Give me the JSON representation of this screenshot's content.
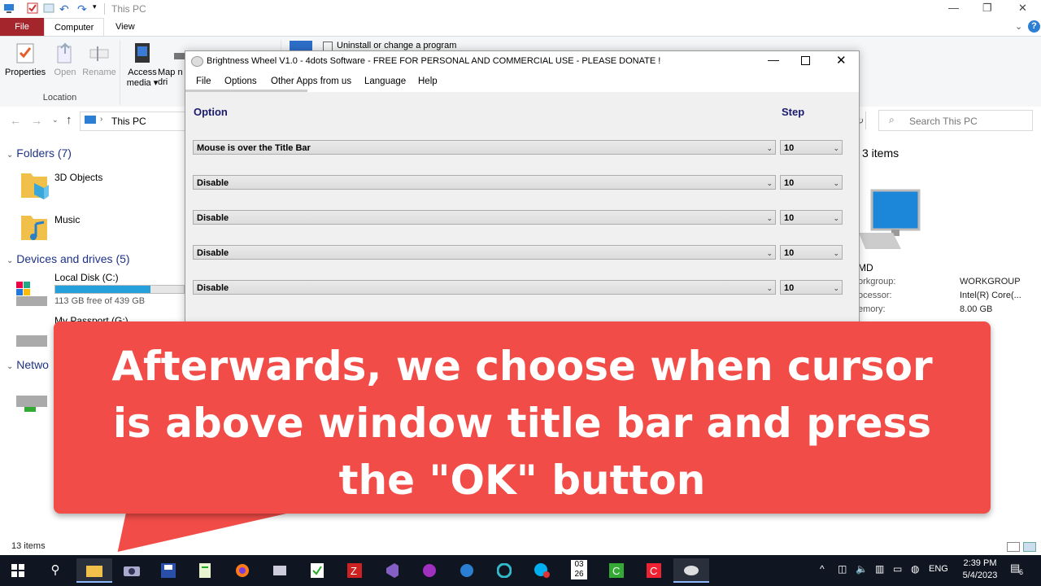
{
  "explorer": {
    "title": "This PC",
    "tabs": [
      "File",
      "Computer",
      "View"
    ],
    "ribbon_buttons": [
      "Properties",
      "Open",
      "Rename",
      "Access media",
      "Map n dri"
    ],
    "ribbon_group": "Location",
    "uninstall_label": "Uninstall or change a program",
    "address": "This PC",
    "search_placeholder": "Search This PC",
    "folders_header": "Folders (7)",
    "folders": [
      "3D Objects",
      "Music"
    ],
    "devices_header": "Devices and drives (5)",
    "drive_c": {
      "name": "Local Disk (C:)",
      "free": "113 GB free of 439 GB",
      "used_fraction": 0.74
    },
    "drive_g": {
      "name": "My Passport (G:)"
    },
    "network_header": "Netwo",
    "items_count": "3 items",
    "status": "13 items",
    "pc_name": "MD",
    "props": [
      {
        "label": "orkgroup:",
        "value": "WORKGROUP"
      },
      {
        "label": "ocessor:",
        "value": "Intel(R) Core(..."
      },
      {
        "label": "emory:",
        "value": "8.00 GB"
      }
    ]
  },
  "dialog": {
    "title": "Brightness Wheel V1.0 - 4dots Software - FREE FOR PERSONAL AND COMMERCIAL USE - PLEASE DONATE !",
    "menu": [
      "File",
      "Options",
      "Other Apps from us",
      "Language",
      "Help"
    ],
    "col_option": "Option",
    "col_step": "Step",
    "rows": [
      {
        "option": "Mouse is over the Title Bar",
        "step": "10"
      },
      {
        "option": "Disable",
        "step": "10"
      },
      {
        "option": "Disable",
        "step": "10"
      },
      {
        "option": "Disable",
        "step": "10"
      },
      {
        "option": "Disable",
        "step": "10"
      }
    ]
  },
  "overlay": {
    "lines": [
      "Afterwards, we choose when cursor",
      "is above window title bar and press",
      "the \"OK\" button"
    ]
  },
  "taskbar": {
    "time": "2:39 PM",
    "date": "5/4/2023",
    "lang": "ENG",
    "notifications": "6",
    "calendar_month": "03",
    "calendar_day": "26"
  },
  "colors": {
    "file_tab": "#a4262c",
    "callout": "#f14c47",
    "taskbar": "#101522",
    "drive_bar": "#26a0da"
  }
}
